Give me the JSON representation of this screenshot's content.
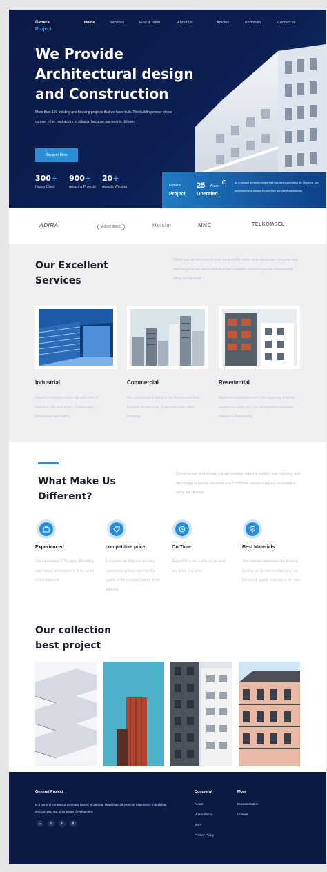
{
  "brand": {
    "line1": "General",
    "line2": "Project"
  },
  "nav": [
    "Home",
    "Services",
    "Find a Team",
    "About Us",
    "Articles",
    "Portofolio",
    "Contact us"
  ],
  "hero": {
    "title": "We Provide Architectural design and Construction",
    "description": "More than 100 building and housing projects that we have built. The building owner chose us over other contractors in Jakarta, because our work is different",
    "button": "Discover More",
    "stats": [
      {
        "value": "300",
        "suffix": "+",
        "label": "Happy Client"
      },
      {
        "value": "900",
        "suffix": "+",
        "label": "Amazing Projects"
      },
      {
        "value": "20",
        "suffix": "+",
        "label": "Awards Winning"
      }
    ],
    "info": {
      "general": "General",
      "project": "Project",
      "years_num": "25",
      "years_label": "Years",
      "operated": "Operated",
      "note": "as a trusted general project that has been operating for 25 years, our commitment is always to prioritize our client satisfaction"
    }
  },
  "logos": [
    "ADIRA",
    "ADHI BKC",
    "Holcim",
    "MNC",
    "TELKOMSEL"
  ],
  "services": {
    "title_line1": "Our Excellent",
    "title_line2": "Services",
    "description": "Check out our best service you can possibly orders in building your company and don't forget to ask via our email or our customer service if you are interested in using our services",
    "items": [
      {
        "title": "Industrial",
        "description": "Industrial development is our main line of business. We do Factory Construction, Warehouse and others"
      },
      {
        "title": "Commercial",
        "description": "Our experience building in the Commercial field includes Showrooms, Supermalls and Office Buildings"
      },
      {
        "title": "Resedential",
        "description": "Residential development is the beginning that has shaped us to this day. Our development includes Houses & Apartments"
      }
    ]
  },
  "different": {
    "title_line1": "What Make Us",
    "title_line2": "Different?",
    "description": "Check out our best service you can possibly orders in building your company and don't forget to ask via our email or our customer service if you are interested in using our services",
    "features": [
      {
        "icon": "briefcase-icon",
        "title": "Experienced",
        "description": "Our experience of 25 years of building and making achievements in the world of development"
      },
      {
        "icon": "tag-icon",
        "title": "competitive price",
        "description": "The prices we offer you are very competitive without reducing the quality of the company's work in the slightest"
      },
      {
        "icon": "clock-icon",
        "title": "On Time",
        "description": "We prioritize the quality of our work and finish it on time"
      },
      {
        "icon": "shield-icon",
        "title": "Best Materials",
        "description": "The material determines the building itself so we recommend that you use the best & quality materials in its class"
      }
    ]
  },
  "collection": {
    "title_line1": "Our collection",
    "title_line2": "best project"
  },
  "footer": {
    "brand": "General Project",
    "description": "is a general contractor company based in Jakarta. More than 25 years of experience in building and carrying out Indonesia's development.",
    "social": [
      "G",
      "t",
      "in",
      "li"
    ],
    "company_head": "Company",
    "company_links": [
      "About",
      "How it Works",
      "Term",
      "Privacy Policy"
    ],
    "more_head": "More",
    "more_links": [
      "Documentation",
      "License"
    ]
  },
  "colors": {
    "navy": "#0b1a45",
    "accent": "#2b8fd8",
    "light_bg": "#efeff1"
  }
}
